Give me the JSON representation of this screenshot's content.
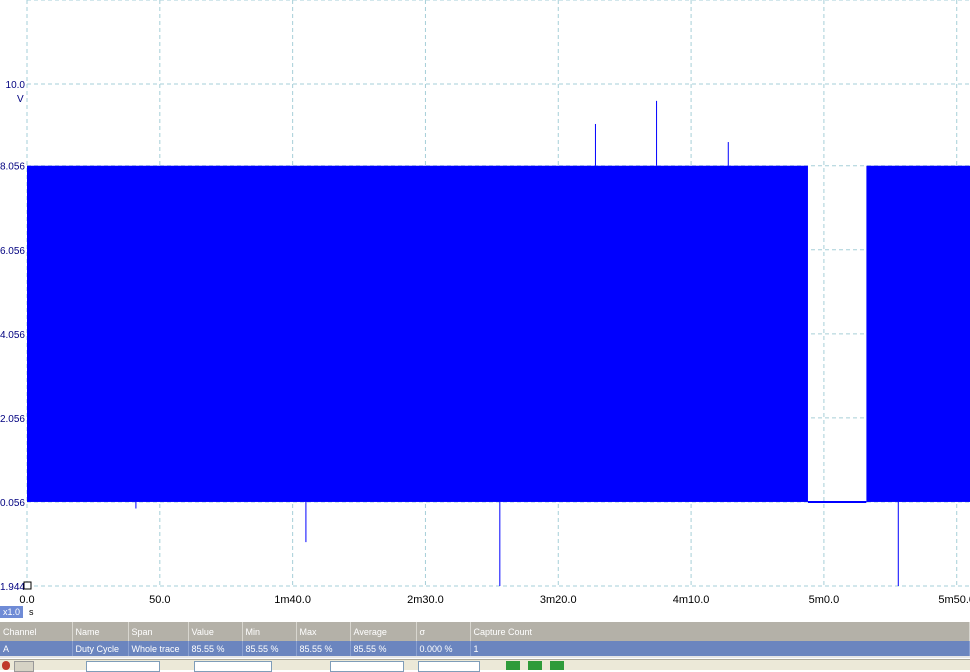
{
  "chart_data": {
    "type": "line",
    "y_unit_label": "V",
    "y_ticks": [
      "10.0",
      "8.056",
      "6.056",
      "4.056",
      "2.056",
      "0.056",
      "-1.944"
    ],
    "x_ticks": [
      "0.0",
      "50.0",
      "1m40.0",
      "2m30.0",
      "3m20.0",
      "4m10.0",
      "5m0.0",
      "5m50.0"
    ],
    "x_unit_label": "s",
    "x_range_s": [
      0,
      355
    ],
    "y_range_v": [
      -1.944,
      12
    ],
    "trace_color": "#0000ff",
    "grid": true,
    "signal": {
      "high_v": 8.056,
      "low_v": 0.056,
      "segments_s": [
        [
          0,
          294
        ],
        [
          316,
          355
        ]
      ],
      "gap_s": [
        294,
        316
      ]
    },
    "spikes": [
      {
        "t_s": 214,
        "v": 9.05
      },
      {
        "t_s": 237,
        "v": 9.6
      },
      {
        "t_s": 264,
        "v": 8.62
      },
      {
        "t_s": 41,
        "v": -0.1
      },
      {
        "t_s": 105,
        "v": -0.9
      },
      {
        "t_s": 178,
        "v": -1.944
      },
      {
        "t_s": 328,
        "v": -1.944
      }
    ]
  },
  "zoom_label": "x1.0",
  "measurements": {
    "headers": [
      "Channel",
      "Name",
      "Span",
      "Value",
      "Min",
      "Max",
      "Average",
      "σ",
      "Capture Count"
    ],
    "rows": [
      {
        "channel": "A",
        "name": "Duty Cycle",
        "span": "Whole trace",
        "value": "85.55 %",
        "min": "85.55 %",
        "max": "85.55 %",
        "average": "85.55 %",
        "sigma": "0.000 %",
        "count": "1"
      }
    ]
  },
  "colors": {
    "grid": "#a6cfd8",
    "axis_text": "#000080",
    "header_bg": "#b4b1a8",
    "row_bg": "#6b85bf"
  }
}
